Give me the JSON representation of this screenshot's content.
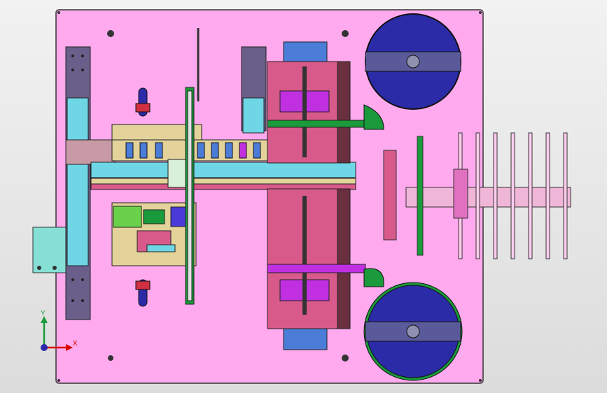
{
  "viewport": {
    "axis_y_label": "Y",
    "axis_x_label": "X"
  },
  "colors": {
    "background": "#e5e5e5",
    "plate": "#ffaaee",
    "disc": "#2b2ba8",
    "disc_rim": "#1a9a3a",
    "frame_slate": "#6a5f8a",
    "frame_cyan": "#6fd6e6",
    "module_pink": "#d85a8a",
    "module_magenta": "#c030e0",
    "module_tan": "#e3d29a",
    "module_green": "#6ad24a",
    "module_blue": "#4a7cd8",
    "motor_box": "#86e0d6"
  },
  "icons": {
    "triad": "coordinate-triad-icon"
  }
}
